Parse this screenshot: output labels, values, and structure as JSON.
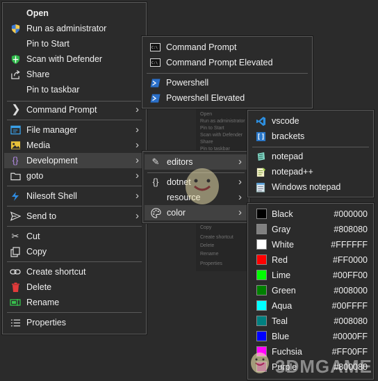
{
  "main_menu": {
    "open": "Open",
    "run_as_admin": "Run as administrator",
    "pin_to_start": "Pin to Start",
    "scan_defender": "Scan with Defender",
    "share": "Share",
    "pin_taskbar": "Pin to taskbar",
    "command_prompt": "Command Prompt",
    "file_manager": "File manager",
    "media": "Media",
    "development": "Development",
    "goto": "goto",
    "nilesoft_shell": "Nilesoft Shell",
    "send_to": "Send to",
    "cut": "Cut",
    "copy": "Copy",
    "create_shortcut": "Create shortcut",
    "delete": "Delete",
    "rename": "Rename",
    "properties": "Properties"
  },
  "cmd_menu": {
    "command_prompt": "Command Prompt",
    "command_prompt_elevated": "Command Prompt Elevated",
    "powershell": "Powershell",
    "powershell_elevated": "Powershell Elevated"
  },
  "dev_menu": {
    "editors": "editors",
    "dotnet": "dotnet",
    "resource": "resource",
    "color": "color"
  },
  "editors_menu": {
    "vscode": "vscode",
    "brackets": "brackets",
    "notepad": "notepad",
    "notepadpp": "notepad++",
    "windows_notepad": "Windows notepad"
  },
  "colors": [
    {
      "name": "Black",
      "hex": "#000000"
    },
    {
      "name": "Gray",
      "hex": "#808080"
    },
    {
      "name": "White",
      "hex": "#FFFFFF"
    },
    {
      "name": "Red",
      "hex": "#FF0000"
    },
    {
      "name": "Lime",
      "hex": "#00FF00"
    },
    {
      "name": "Green",
      "hex": "#008000"
    },
    {
      "name": "Aqua",
      "hex": "#00FFFF"
    },
    {
      "name": "Teal",
      "hex": "#008080"
    },
    {
      "name": "Blue",
      "hex": "#0000FF"
    },
    {
      "name": "Fuchsia",
      "hex": "#FF00FF"
    },
    {
      "name": "Purple",
      "hex": "#800080"
    }
  ],
  "background_menu_items": [
    "Open",
    "Run as administrator",
    "Pin to Start",
    "Scan with Defender",
    "Share",
    "Pin to taskbar"
  ],
  "background_menu_items_2": [
    "Copy",
    "Create shortcut",
    "Delete",
    "Rename",
    "Properties"
  ],
  "watermark": "3DMGAME",
  "theme": {
    "background": "#2b2b2b",
    "highlight": "#414141",
    "border": "#5a5a5a"
  }
}
